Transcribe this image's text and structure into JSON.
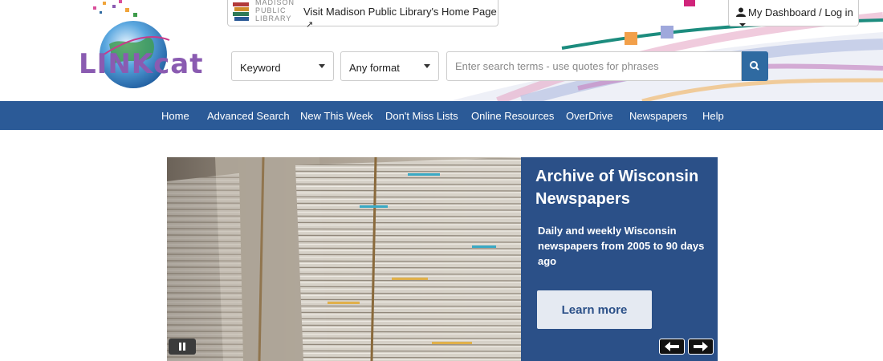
{
  "brand": {
    "logo_text": "LINKcat"
  },
  "library_link": {
    "logo_lines": [
      "MADISON",
      "PUBLIC",
      "LIBRARY"
    ],
    "label": "Visit Madison Public Library's Home Page",
    "icon": "external-link-icon"
  },
  "account": {
    "label": "My Dashboard / Log in",
    "icon": "user-icon"
  },
  "search": {
    "type_value": "Keyword",
    "format_value": "Any format",
    "placeholder": "Enter search terms - use quotes for phrases",
    "button_icon": "search-icon"
  },
  "nav": {
    "items": [
      "Home",
      "Advanced Search",
      "New This Week",
      "Don't Miss Lists",
      "Online Resources",
      "OverDrive",
      "Newspapers",
      "Help"
    ]
  },
  "carousel": {
    "title": "Archive of Wisconsin Newspapers",
    "subtitle": "Daily and weekly Wisconsin newspapers from 2005 to 90 days ago",
    "button_label": "Learn more",
    "pause_icon": "pause-icon",
    "prev_icon": "arrow-left-icon",
    "next_icon": "arrow-right-icon"
  },
  "colors": {
    "nav_bg": "#2b5a97",
    "panel_bg": "#2b5088",
    "search_button": "#2f6aa1",
    "logo_purple": "#8a5bb1"
  }
}
